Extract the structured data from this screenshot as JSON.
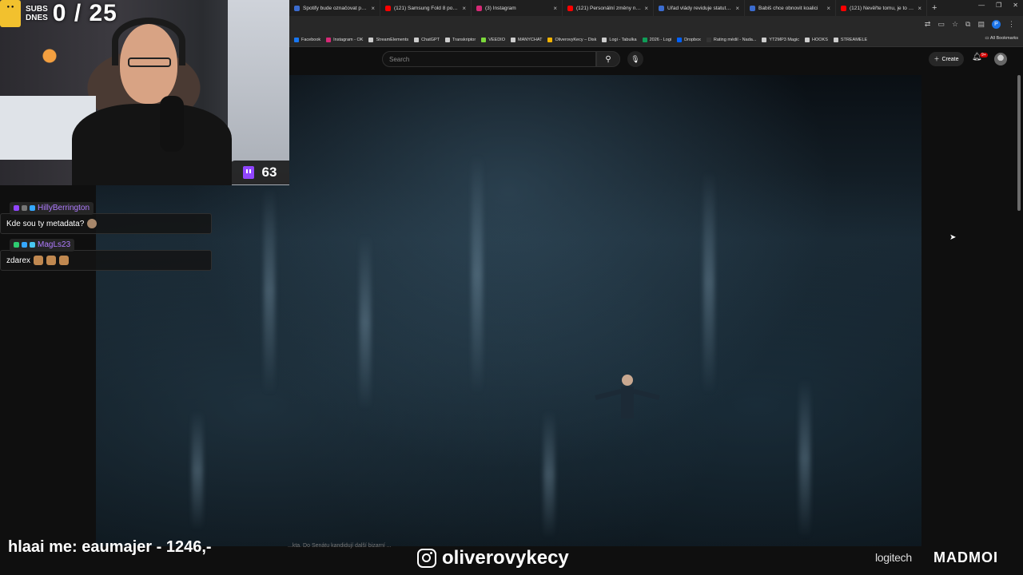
{
  "browser": {
    "tabs": [
      {
        "title": "Spotify bude označovat pers",
        "icon_color": "#3b6ccf"
      },
      {
        "title": "(121) Samsung Fold 8 po Tý",
        "icon_color": "#ff0000"
      },
      {
        "title": "(3) Instagram",
        "icon_color": "#d62976"
      },
      {
        "title": "(121) Personální změny na pr",
        "icon_color": "#ff0000"
      },
      {
        "title": "Úřad vlády reviduje statuty vl",
        "icon_color": "#3b6ccf"
      },
      {
        "title": "Babiš chce obnovit koalici",
        "icon_color": "#3b6ccf"
      },
      {
        "title": "(121) Nevěřte tomu, je to PR",
        "icon_color": "#ff0000"
      }
    ],
    "new_tab": "+",
    "profile_letter": "P",
    "bookmarks": [
      {
        "label": "Facebook",
        "color": "#1877f2"
      },
      {
        "label": "Instagram - OK",
        "color": "#d62976"
      },
      {
        "label": "StreamElements",
        "color": "#cccccc"
      },
      {
        "label": "ChatGPT",
        "color": "#cccccc"
      },
      {
        "label": "Transkriptor",
        "color": "#cccccc"
      },
      {
        "label": "VEEDIO",
        "color": "#7cd93b"
      },
      {
        "label": "MANYCHAT",
        "color": "#cccccc"
      },
      {
        "label": "OliverovyKecy – Disk",
        "color": "#f4b400"
      },
      {
        "label": "Logi - Tabulka",
        "color": "#cccccc"
      },
      {
        "label": "2026 - Logi",
        "color": "#0f9d58"
      },
      {
        "label": "Dropbox",
        "color": "#0061ff"
      },
      {
        "label": "Rating médií - Nada...",
        "color": "#333333"
      },
      {
        "label": "YT2MP3 Magic",
        "color": "#cccccc"
      },
      {
        "label": "HOOKS",
        "color": "#cccccc"
      },
      {
        "label": "STREAMELE",
        "color": "#cccccc"
      }
    ],
    "all_bookmarks": "All Bookmarks"
  },
  "youtube": {
    "search_placeholder": "Search",
    "create_label": "Create",
    "notif_badge": "9+"
  },
  "stream": {
    "subs_label_line1": "SUBS",
    "subs_label_line2": "DNES",
    "subs_counter": "0 / 25",
    "viewer_count": "63",
    "chat": [
      {
        "user": "HillyBerrington",
        "message": "Kde sou ty metadata?"
      },
      {
        "user": "MagLs23",
        "message": "zdarex"
      }
    ],
    "ticker_text": "hlaai me: eaumajer - 1246,-",
    "ticker_bg_text": "...kta. Do Senátu kandidují další bizarní ...",
    "instagram_handle": "oliverovykecy",
    "sponsor_1": "logitech",
    "sponsor_2": "MADMOI"
  }
}
